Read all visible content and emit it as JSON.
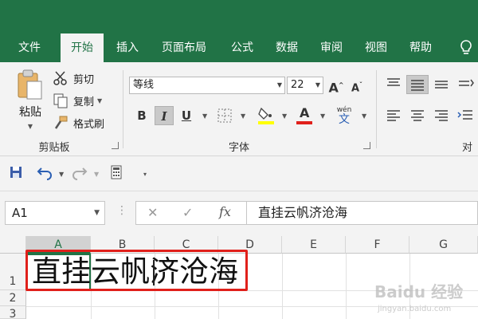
{
  "ribbon_tabs": {
    "file": "文件",
    "home": "开始",
    "insert": "插入",
    "layout": "页面布局",
    "formulas": "公式",
    "data": "数据",
    "review": "审阅",
    "view": "视图",
    "help": "帮助"
  },
  "clipboard": {
    "paste": "粘贴",
    "cut": "剪切",
    "copy": "复制",
    "format_painter": "格式刷",
    "group_label": "剪贴板"
  },
  "font": {
    "name": "等线",
    "size": "22",
    "group_label": "字体",
    "bold": "B",
    "italic": "I",
    "underline": "U",
    "phonetic": "wén",
    "phonetic_char": "文",
    "highlight_color": "#ffff00",
    "font_color": "#e0201b"
  },
  "alignment": {
    "group_label_partial": "对"
  },
  "name_box": {
    "value": "A1"
  },
  "formula_bar": {
    "cancel": "✕",
    "enter": "✓",
    "fx": "fx",
    "content": "直挂云帆济沧海"
  },
  "sheet": {
    "columns": [
      "A",
      "B",
      "C",
      "D",
      "E",
      "F",
      "G"
    ],
    "rows": [
      "1",
      "2",
      "3"
    ],
    "cell_a1": "直挂云帆济沧海"
  },
  "watermark": {
    "text": "Baidu 经验",
    "sub": "jingyan.baidu.com"
  },
  "colors": {
    "brand_green": "#217346",
    "highlight_red": "#e0201b"
  }
}
